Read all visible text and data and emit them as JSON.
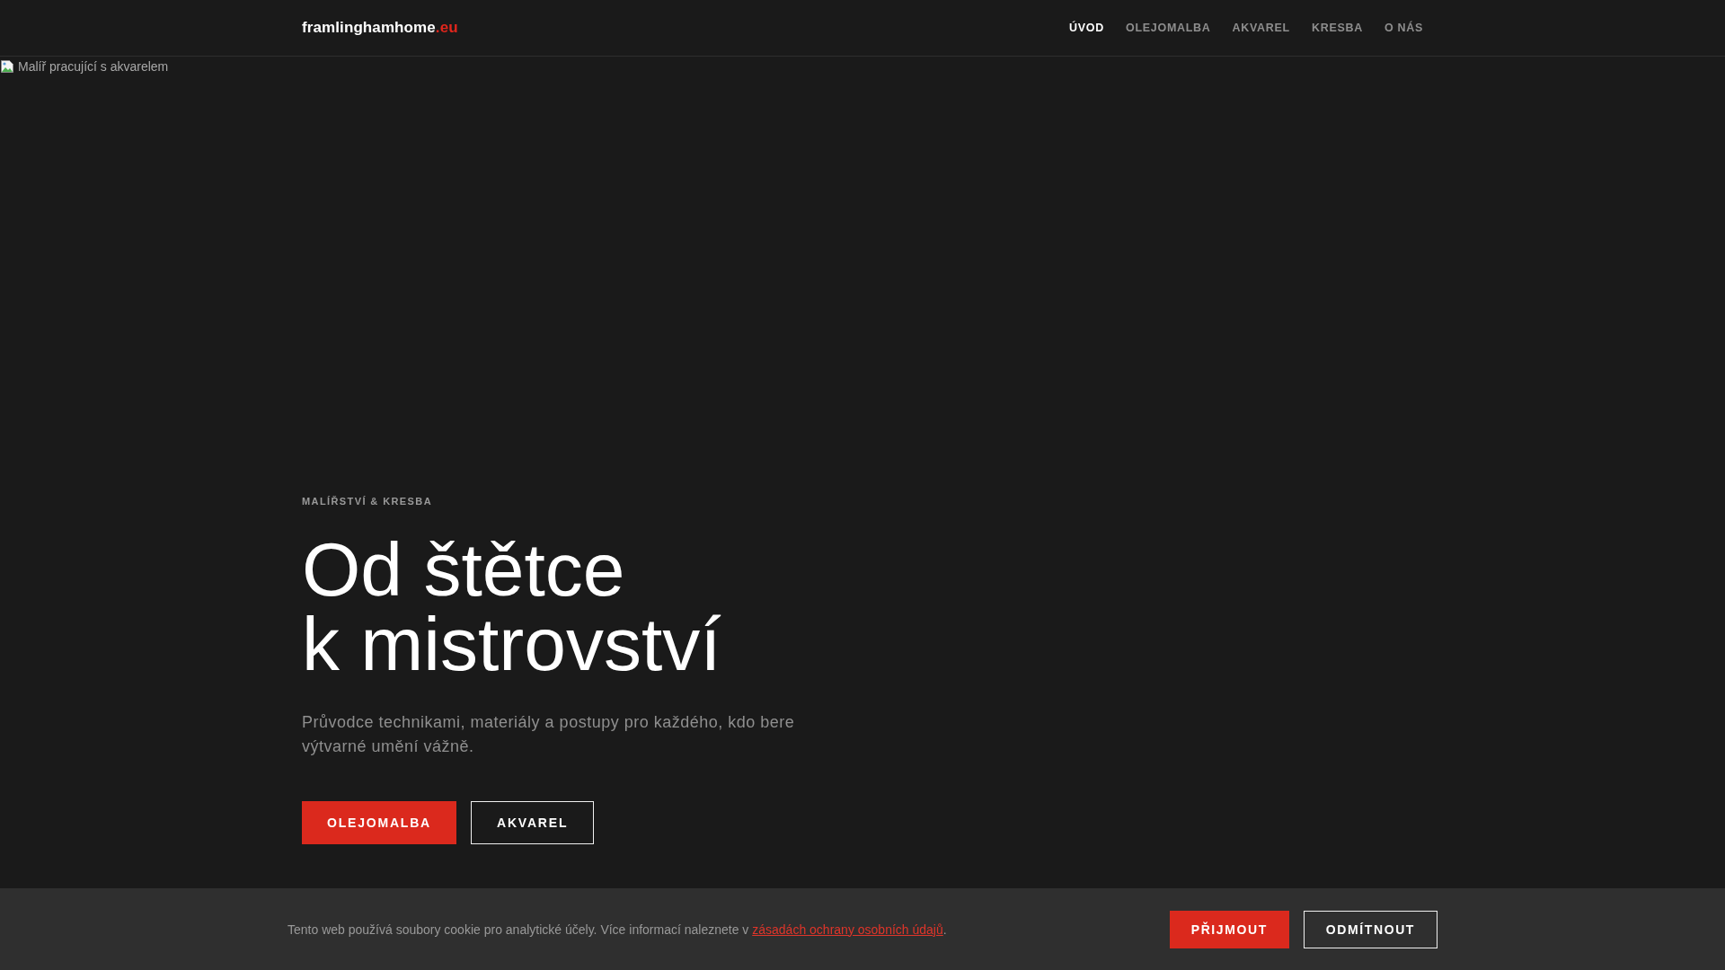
{
  "header": {
    "logo": {
      "name": "framlinghamhome",
      "domain": ".eu"
    },
    "nav": [
      {
        "label": "ÚVOD",
        "selected": true
      },
      {
        "label": "OLEJOMALBA",
        "selected": false
      },
      {
        "label": "AKVAREL",
        "selected": false
      },
      {
        "label": "KRESBA",
        "selected": false
      },
      {
        "label": "O NÁS",
        "selected": false
      }
    ]
  },
  "hero": {
    "image_alt": "Malíř pracující s akvarelem",
    "eyebrow": "MALÍŘSTVÍ & KRESBA",
    "title_lines": [
      "Od štětce",
      "k mistrovství"
    ],
    "lead": "Průvodce technikami, materiály a postupy pro každého, kdo bere výtvarné umění vážně.",
    "buttons": [
      {
        "label": "OLEJOMALBA",
        "kind": "primary"
      },
      {
        "label": "AKVAREL",
        "kind": "outline"
      }
    ]
  },
  "cookie_bar": {
    "text": "Tento web používá soubory cookie pro analytické účely. Více informací naleznete v",
    "link": "zásadách ochrany osobních údajů",
    "text_end": ".",
    "buttons": [
      {
        "label": "PŘIJMOUT",
        "kind": "primary"
      },
      {
        "label": "ODMÍTNOUT",
        "kind": "outline"
      }
    ]
  }
}
